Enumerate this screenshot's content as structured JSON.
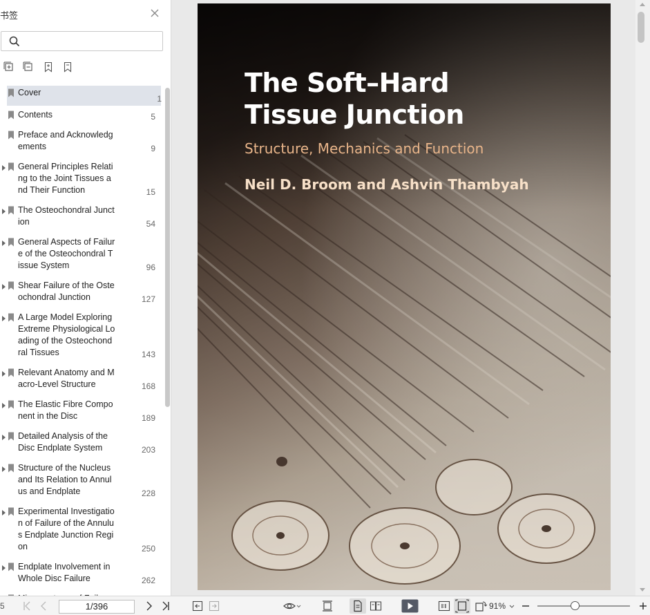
{
  "sidebar": {
    "title": "书签",
    "search": {
      "value": "",
      "placeholder": ""
    },
    "tool_icons": [
      "expand-all-icon",
      "collapse-all-icon",
      "add-bookmark-icon",
      "bookmark-icon"
    ],
    "bookmarks": [
      {
        "label": "Cover",
        "page": "1",
        "expandable": false,
        "active": true
      },
      {
        "label": "Contents",
        "page": "5",
        "expandable": false,
        "active": false
      },
      {
        "label": "Preface and Acknowledg\nements",
        "page": "9",
        "expandable": false,
        "active": false
      },
      {
        "label": "General Principles Relati\nng to the Joint Tissues a\nnd Their Function",
        "page": "15",
        "expandable": true,
        "active": false
      },
      {
        "label": "The Osteochondral Junct\nion",
        "page": "54",
        "expandable": true,
        "active": false
      },
      {
        "label": "General Aspects of Failur\ne of the Osteochondral T\nissue System",
        "page": "96",
        "expandable": true,
        "active": false
      },
      {
        "label": "Shear Failure of the Oste\nochondral Junction",
        "page": "127",
        "expandable": true,
        "active": false
      },
      {
        "label": "A Large Model Exploring\nExtreme Physiological Lo\nading of the Osteochond\nral Tissues",
        "page": "143",
        "expandable": true,
        "active": false
      },
      {
        "label": "Relevant Anatomy and M\nacro-Level Structure",
        "page": "168",
        "expandable": true,
        "active": false
      },
      {
        "label": "The Elastic Fibre Compo\nnent in the Disc",
        "page": "189",
        "expandable": true,
        "active": false
      },
      {
        "label": "Detailed Analysis of the\nDisc Endplate System",
        "page": "203",
        "expandable": true,
        "active": false
      },
      {
        "label": "Structure of the Nucleus\nand Its Relation to Annul\nus and Endplate",
        "page": "228",
        "expandable": true,
        "active": false
      },
      {
        "label": "Experimental Investigatio\nn of Failure of the Annulu\ns Endplate Junction Regi\non",
        "page": "250",
        "expandable": true,
        "active": false
      },
      {
        "label": "Endplate Involvement in\nWhole Disc Failure",
        "page": "262",
        "expandable": true,
        "active": false
      },
      {
        "label": "Microanatomy of Fail",
        "page": "",
        "expandable": true,
        "active": false
      }
    ]
  },
  "cover": {
    "title": "The Soft–Hard\nTissue Junction",
    "subtitle": "Structure, Mechanics and Function",
    "authors": "Neil D. Broom and Ashvin Thambyah"
  },
  "statusbar": {
    "left_fragment": "5",
    "page_indicator": "1/396",
    "zoom": "91%",
    "zoom_level": 0.41
  },
  "colors": {
    "subtitle": "#e9b58a",
    "active_bookmark_bg": "#dfe3ea",
    "play_button": "#555a66"
  }
}
